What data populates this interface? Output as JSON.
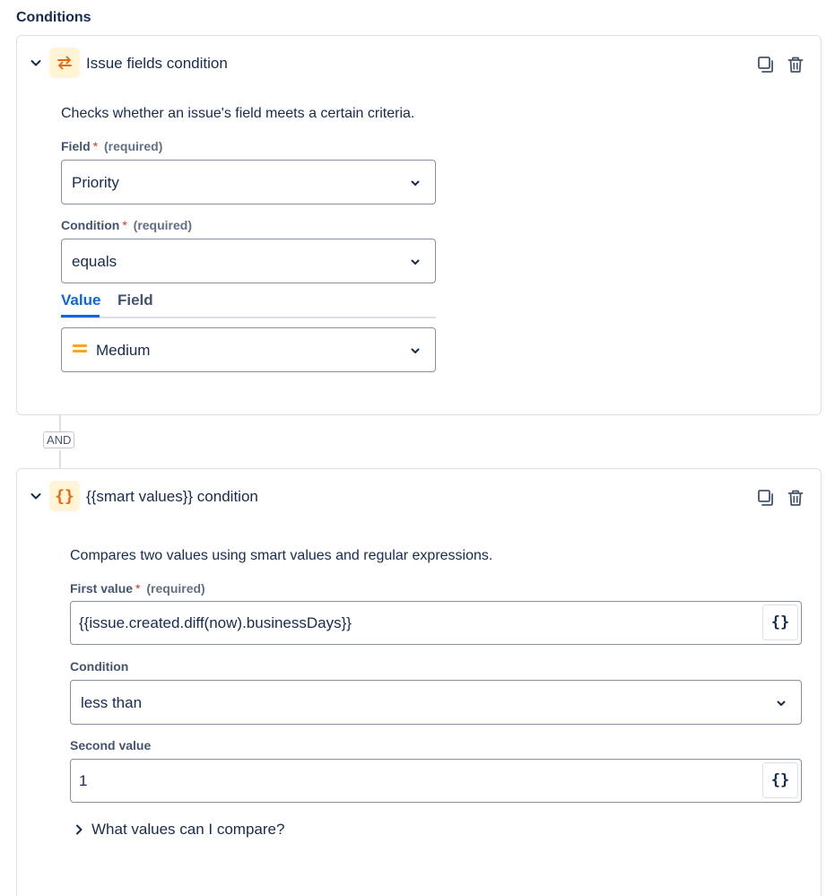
{
  "section": {
    "title": "Conditions"
  },
  "conditions": [
    {
      "title": "Issue fields condition",
      "icon": "swap-arrows-icon",
      "description": "Checks whether an issue's field meets a certain criteria.",
      "field": {
        "label": "Field",
        "required_star": "*",
        "required_text": "(required)",
        "value": "Priority"
      },
      "condition": {
        "label": "Condition",
        "required_star": "*",
        "required_text": "(required)",
        "value": "equals"
      },
      "tabs": [
        {
          "label": "Value",
          "active": true
        },
        {
          "label": "Field",
          "active": false
        }
      ],
      "value_select": {
        "value": "Medium",
        "icon": "priority-medium-icon"
      }
    },
    {
      "title": "{{smart values}} condition",
      "icon": "curly-braces-icon",
      "icon_glyph": "{}",
      "description": "Compares two values using smart values and regular expressions.",
      "first_value": {
        "label": "First value",
        "required_star": "*",
        "required_text": "(required)",
        "value": "{{issue.created.diff(now).businessDays}}",
        "button_glyph": "{}"
      },
      "condition": {
        "label": "Condition",
        "value": "less than"
      },
      "second_value": {
        "label": "Second value",
        "value": "1",
        "button_glyph": "{}"
      },
      "expander": "What values can I compare?"
    }
  ],
  "connector": {
    "label": "AND"
  },
  "colors": {
    "accent_blue": "#0c66e4",
    "icon_orange": "#e56910",
    "icon_bg": "#fff4d6",
    "required_red": "#c9372c",
    "medium_priority": "#f5a623"
  }
}
